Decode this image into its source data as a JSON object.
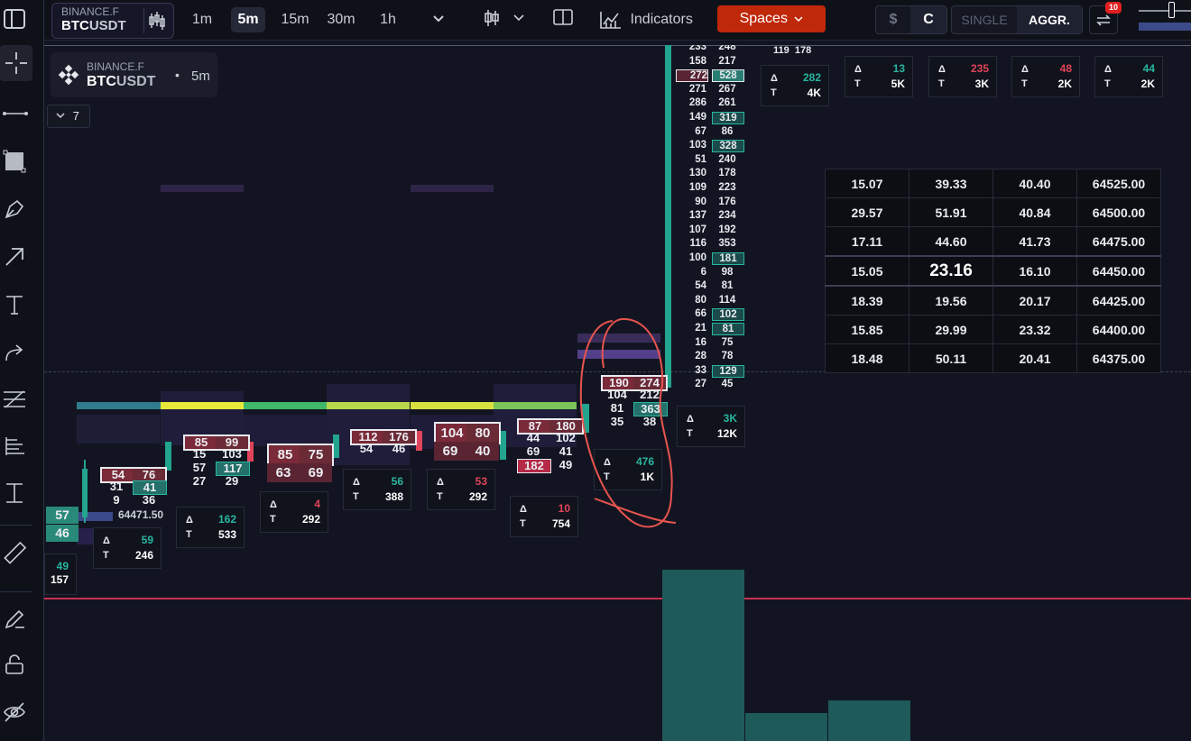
{
  "header": {
    "exchange": "BINANCE.F",
    "symbol_base": "BTC",
    "symbol_quote": "USDT",
    "timeframes": [
      "1m",
      "5m",
      "15m",
      "30m",
      "1h"
    ],
    "active_timeframe": "5m",
    "indicators_label": "Indicators",
    "spaces_label": "Spaces",
    "currency_symbol": "$",
    "currency_alt": "C",
    "single_label": "SINGLE",
    "aggr_label": "AGGR.",
    "notification_count": "10"
  },
  "legend": {
    "exchange": "BINANCE.F",
    "symbol_base": "BTC",
    "symbol_quote": "USDT",
    "separator": "•",
    "timeframe": "5m",
    "indicator_count": "7"
  },
  "colors": {
    "accent_red": "#e0445a",
    "accent_green": "#29b6a0",
    "spaces_bg": "#c0280a",
    "price_line": "#c9304e"
  },
  "top_stats": [
    {
      "delta": "282",
      "total": "4K",
      "delta_color": "green"
    },
    {
      "delta": "13",
      "total": "5K",
      "delta_color": "green"
    },
    {
      "delta": "235",
      "total": "3K",
      "delta_color": "red"
    },
    {
      "delta": "48",
      "total": "2K",
      "delta_color": "red"
    },
    {
      "delta": "44",
      "total": "2K",
      "delta_color": "green"
    }
  ],
  "candle_stats": [
    {
      "delta": "49",
      "total": "157",
      "delta_color": "green"
    },
    {
      "delta": "59",
      "total": "246",
      "delta_color": "green"
    },
    {
      "delta": "162",
      "total": "533",
      "delta_color": "green"
    },
    {
      "delta": "4",
      "total": "292",
      "delta_color": "red"
    },
    {
      "delta": "56",
      "total": "388",
      "delta_color": "green"
    },
    {
      "delta": "53",
      "total": "292",
      "delta_color": "red"
    },
    {
      "delta": "10",
      "total": "754",
      "delta_color": "red"
    },
    {
      "delta": "476",
      "total": "1K",
      "delta_color": "green"
    },
    {
      "delta": "3K",
      "total": "12K",
      "delta_color": "green"
    }
  ],
  "big_footprint": [
    [
      "233",
      "248"
    ],
    [
      "158",
      "217"
    ],
    [
      "272",
      "528"
    ],
    [
      "271",
      "267"
    ],
    [
      "286",
      "261"
    ],
    [
      "149",
      "319"
    ],
    [
      "67",
      "86"
    ],
    [
      "103",
      "328"
    ],
    [
      "51",
      "240"
    ],
    [
      "130",
      "178"
    ],
    [
      "109",
      "223"
    ],
    [
      "90",
      "176"
    ],
    [
      "137",
      "234"
    ],
    [
      "107",
      "192"
    ],
    [
      "116",
      "353"
    ],
    [
      "100",
      "181"
    ],
    [
      "6",
      "98"
    ],
    [
      "54",
      "81"
    ],
    [
      "80",
      "114"
    ],
    [
      "66",
      "102"
    ],
    [
      "21",
      "81"
    ],
    [
      "16",
      "75"
    ],
    [
      "28",
      "78"
    ],
    [
      "33",
      "129"
    ],
    [
      "27",
      "45"
    ]
  ],
  "top_partial": [
    "119",
    "178"
  ],
  "candles": [
    {
      "rows": [
        [
          "57",
          ""
        ],
        [
          "46",
          ""
        ]
      ]
    },
    {
      "rows": [
        [
          "54",
          "76"
        ],
        [
          "31",
          "41"
        ],
        [
          "9",
          "36"
        ]
      ]
    },
    {
      "rows": [
        [
          "85",
          "99"
        ],
        [
          "15",
          "103"
        ],
        [
          "57",
          "117"
        ],
        [
          "27",
          "29"
        ]
      ]
    },
    {
      "rows": [
        [
          "85",
          "75"
        ],
        [
          "63",
          "69"
        ]
      ]
    },
    {
      "rows": [
        [
          "112",
          "176"
        ],
        [
          "54",
          "46"
        ]
      ]
    },
    {
      "rows": [
        [
          "104",
          "80"
        ],
        [
          "69",
          "40"
        ]
      ]
    },
    {
      "rows": [
        [
          "87",
          "180"
        ],
        [
          "44",
          "102"
        ],
        [
          "69",
          "41"
        ],
        [
          "182",
          "49"
        ]
      ]
    },
    {
      "rows": [
        [
          "190",
          "274"
        ],
        [
          "104",
          "212"
        ],
        [
          "81",
          "363"
        ],
        [
          "35",
          "38"
        ]
      ]
    }
  ],
  "stray_label": "64471.50",
  "dom_table": [
    [
      "15.07",
      "39.33",
      "40.40",
      "64525.00"
    ],
    [
      "29.57",
      "51.91",
      "40.84",
      "64500.00"
    ],
    [
      "17.11",
      "44.60",
      "41.73",
      "64475.00"
    ],
    [
      "15.05",
      "23.16",
      "16.10",
      "64450.00"
    ],
    [
      "18.39",
      "19.56",
      "20.17",
      "64425.00"
    ],
    [
      "15.85",
      "29.99",
      "23.32",
      "64400.00"
    ],
    [
      "18.48",
      "50.11",
      "20.41",
      "64375.00"
    ]
  ],
  "stat_labels": {
    "delta": "Δ",
    "total": "T"
  }
}
